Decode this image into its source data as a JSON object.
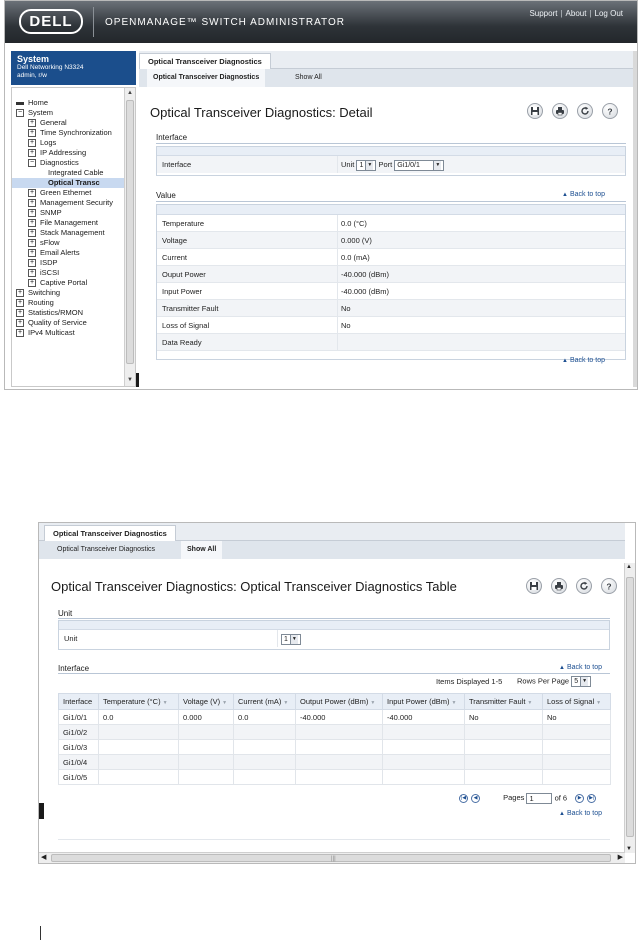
{
  "header": {
    "logo": "DELL",
    "app_title": "OPENMANAGE™ SWITCH ADMINISTRATOR",
    "links": [
      "Support",
      "About",
      "Log Out"
    ]
  },
  "sidebar": {
    "title": "System",
    "device": "Dell Networking N3324",
    "user": "admin, r/w",
    "tree": [
      {
        "label": "Home",
        "indent": 0,
        "mark": "bar"
      },
      {
        "label": "System",
        "indent": 0,
        "mark": "minus"
      },
      {
        "label": "General",
        "indent": 1,
        "mark": "plus"
      },
      {
        "label": "Time Synchronization",
        "indent": 1,
        "mark": "plus"
      },
      {
        "label": "Logs",
        "indent": 1,
        "mark": "plus"
      },
      {
        "label": "IP Addressing",
        "indent": 1,
        "mark": "plus"
      },
      {
        "label": "Diagnostics",
        "indent": 1,
        "mark": "minus"
      },
      {
        "label": "Integrated Cable",
        "indent": 2,
        "mark": "none"
      },
      {
        "label": "Optical Transc",
        "indent": 2,
        "mark": "none",
        "selected": true
      },
      {
        "label": "Green Ethernet",
        "indent": 1,
        "mark": "plus"
      },
      {
        "label": "Management Security",
        "indent": 1,
        "mark": "plus"
      },
      {
        "label": "SNMP",
        "indent": 1,
        "mark": "plus"
      },
      {
        "label": "File Management",
        "indent": 1,
        "mark": "plus"
      },
      {
        "label": "Stack Management",
        "indent": 1,
        "mark": "plus"
      },
      {
        "label": "sFlow",
        "indent": 1,
        "mark": "plus"
      },
      {
        "label": "Email Alerts",
        "indent": 1,
        "mark": "plus"
      },
      {
        "label": "ISDP",
        "indent": 1,
        "mark": "plus"
      },
      {
        "label": "iSCSI",
        "indent": 1,
        "mark": "plus"
      },
      {
        "label": "Captive Portal",
        "indent": 1,
        "mark": "plus"
      },
      {
        "label": "Switching",
        "indent": 0,
        "mark": "plus"
      },
      {
        "label": "Routing",
        "indent": 0,
        "mark": "plus"
      },
      {
        "label": "Statistics/RMON",
        "indent": 0,
        "mark": "plus"
      },
      {
        "label": "Quality of Service",
        "indent": 0,
        "mark": "plus"
      },
      {
        "label": "IPv4 Multicast",
        "indent": 0,
        "mark": "plus"
      }
    ]
  },
  "detail": {
    "tab": "Optical Transceiver Diagnostics",
    "subtabs": [
      "Optical Transceiver Diagnostics",
      "Show All"
    ],
    "title": "Optical Transceiver Diagnostics: Detail",
    "interface_section": "Interface",
    "interface_label": "Interface",
    "unit_label": "Unit",
    "unit_value": "1",
    "port_label": "Port",
    "port_value": "Gi1/0/1",
    "value_section": "Value",
    "back_to_top": "Back to top",
    "rows": [
      {
        "label": "Temperature",
        "value": "0.0  (°C)"
      },
      {
        "label": "Voltage",
        "value": "0.000  (V)"
      },
      {
        "label": "Current",
        "value": "0.0  (mA)"
      },
      {
        "label": "Ouput Power",
        "value": "-40.000  (dBm)"
      },
      {
        "label": "Input Power",
        "value": "-40.000  (dBm)"
      },
      {
        "label": "Transmitter Fault",
        "value": "No"
      },
      {
        "label": "Loss of Signal",
        "value": "No"
      },
      {
        "label": "Data Ready",
        "value": ""
      }
    ]
  },
  "table_view": {
    "tab": "Optical Transceiver Diagnostics",
    "subtabs": [
      "Optical Transceiver Diagnostics",
      "Show All"
    ],
    "title": "Optical Transceiver Diagnostics: Optical Transceiver Diagnostics Table",
    "unit_section": "Unit",
    "unit_label": "Unit",
    "unit_value": "1",
    "interface_section": "Interface",
    "back_to_top": "Back to top",
    "items_displayed": "Items Displayed  1-5",
    "rows_per_page_label": "Rows Per Page",
    "rows_per_page": "5",
    "columns": [
      "Interface",
      "Temperature (°C)",
      "Voltage (V)",
      "Current (mA)",
      "Output Power (dBm)",
      "Input Power (dBm)",
      "Transmitter Fault",
      "Loss of Signal"
    ],
    "rows": [
      [
        "Gi1/0/1",
        "0.0",
        "0.000",
        "0.0",
        "-40.000",
        "-40.000",
        "No",
        "No"
      ],
      [
        "Gi1/0/2",
        "",
        "",
        "",
        "",
        "",
        "",
        ""
      ],
      [
        "Gi1/0/3",
        "",
        "",
        "",
        "",
        "",
        "",
        ""
      ],
      [
        "Gi1/0/4",
        "",
        "",
        "",
        "",
        "",
        "",
        ""
      ],
      [
        "Gi1/0/5",
        "",
        "",
        "",
        "",
        "",
        "",
        ""
      ]
    ],
    "pages_label": "Pages",
    "page_value": "1",
    "of_pages": "of 6"
  }
}
